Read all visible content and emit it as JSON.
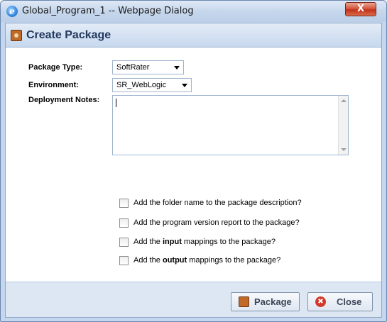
{
  "window": {
    "title": "Global_Program_1 -- Webpage Dialog",
    "browser_icon_glyph": "e",
    "close_glyph": "X"
  },
  "dialog": {
    "title": "Create Package"
  },
  "form": {
    "package_type_label": "Package Type:",
    "package_type_value": "SoftRater",
    "environment_label": "Environment:",
    "environment_value": "SR_WebLogic",
    "deployment_notes_label": "Deployment Notes:",
    "deployment_notes_value": ""
  },
  "options": [
    {
      "prefix": "Add the folder name to the package description?",
      "bold": "",
      "suffix": "",
      "checked": false
    },
    {
      "prefix": "Add the program version report to the package?",
      "bold": "",
      "suffix": "",
      "checked": false
    },
    {
      "prefix": "Add the ",
      "bold": "input",
      "suffix": " mappings to the package?",
      "checked": false
    },
    {
      "prefix": "Add the ",
      "bold": "output",
      "suffix": " mappings to the package?",
      "checked": false
    }
  ],
  "buttons": {
    "package_label": "Package",
    "close_label": "Close",
    "close_icon_glyph": "✖"
  },
  "icons": {
    "browser": "ie-icon",
    "header": "package-icon",
    "package_button": "package-icon",
    "close_button": "close-icon"
  },
  "colors": {
    "header_title": "#23395e",
    "window_frame": "#c5d7ee",
    "close_red": "#d23a2a",
    "package_brown": "#c06a2a"
  }
}
